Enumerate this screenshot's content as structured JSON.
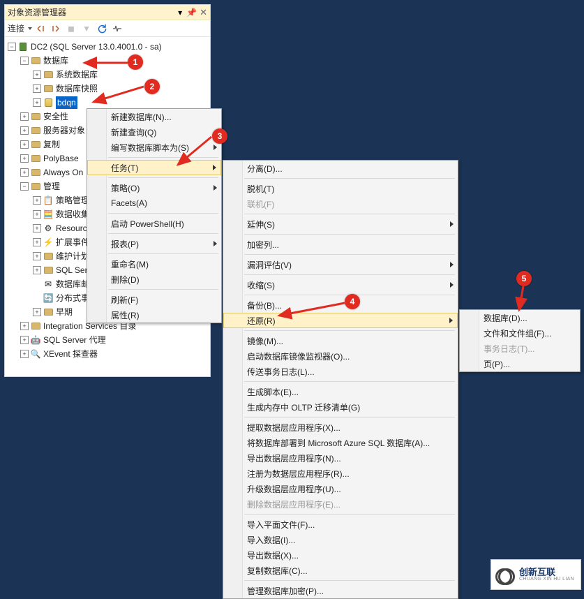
{
  "panel": {
    "title": "对象资源管理器"
  },
  "toolbar": {
    "connect": "连接"
  },
  "tree": {
    "root": "DC2 (SQL Server 13.0.4001.0 - sa)",
    "databases": "数据库",
    "sysdb": "系统数据库",
    "snapshot": "数据库快照",
    "bdqn": "bdqn",
    "security": "安全性",
    "serverobj": "服务器对象",
    "replication": "复制",
    "polybase": "PolyBase",
    "alwayson": "Always On",
    "management": "管理",
    "policy": "策略管理",
    "datacol": "数据收集",
    "resgov": "Resource Governor",
    "xevent": "扩展事件",
    "maint": "维护计划",
    "sqllogs": "SQL Server 日志",
    "dbmail": "数据库邮件",
    "dtx": "分布式事务处理器",
    "legacy": "早期",
    "integration": "Integration Services 目录",
    "agent": "SQL Server 代理",
    "profiler": "XEvent 探查器"
  },
  "menu1": {
    "newdb": "新建数据库(N)...",
    "newquery": "新建查询(Q)",
    "script": "编写数据库脚本为(S)",
    "tasks": "任务(T)",
    "policies": "策略(O)",
    "facets": "Facets(A)",
    "powershell": "启动 PowerShell(H)",
    "reports": "报表(P)",
    "rename": "重命名(M)",
    "delete": "删除(D)",
    "refresh": "刷新(F)",
    "properties": "属性(R)"
  },
  "menu2": {
    "detach": "分离(D)...",
    "offline": "脱机(T)",
    "online": "联机(F)",
    "stretch": "延伸(S)",
    "encrypt": "加密列...",
    "vuln": "漏洞评估(V)",
    "shrink": "收缩(S)",
    "backup": "备份(B)...",
    "restore": "还原(R)",
    "mirror": "镜像(M)...",
    "launchmon": "启动数据库镜像监视器(O)...",
    "shiplog": "传送事务日志(L)...",
    "genscript": "生成脚本(E)...",
    "oltp": "生成内存中 OLTP 迁移清单(G)",
    "extract": "提取数据层应用程序(X)...",
    "deployazure": "将数据库部署到 Microsoft Azure SQL 数据库(A)...",
    "exporttier": "导出数据层应用程序(N)...",
    "regtier": "注册为数据层应用程序(R)...",
    "upgradetier": "升级数据层应用程序(U)...",
    "deltier": "删除数据层应用程序(E)...",
    "importflat": "导入平面文件(F)...",
    "importdata": "导入数据(I)...",
    "exportdata": "导出数据(X)...",
    "copydb": "复制数据库(C)...",
    "managekeys": "管理数据库加密(P)..."
  },
  "menu3": {
    "database": "数据库(D)...",
    "files": "文件和文件组(F)...",
    "txlog": "事务日志(T)...",
    "page": "页(P)..."
  },
  "logo": {
    "main": "创新互联",
    "sub": "CHUANG XIN HU LIAN"
  }
}
